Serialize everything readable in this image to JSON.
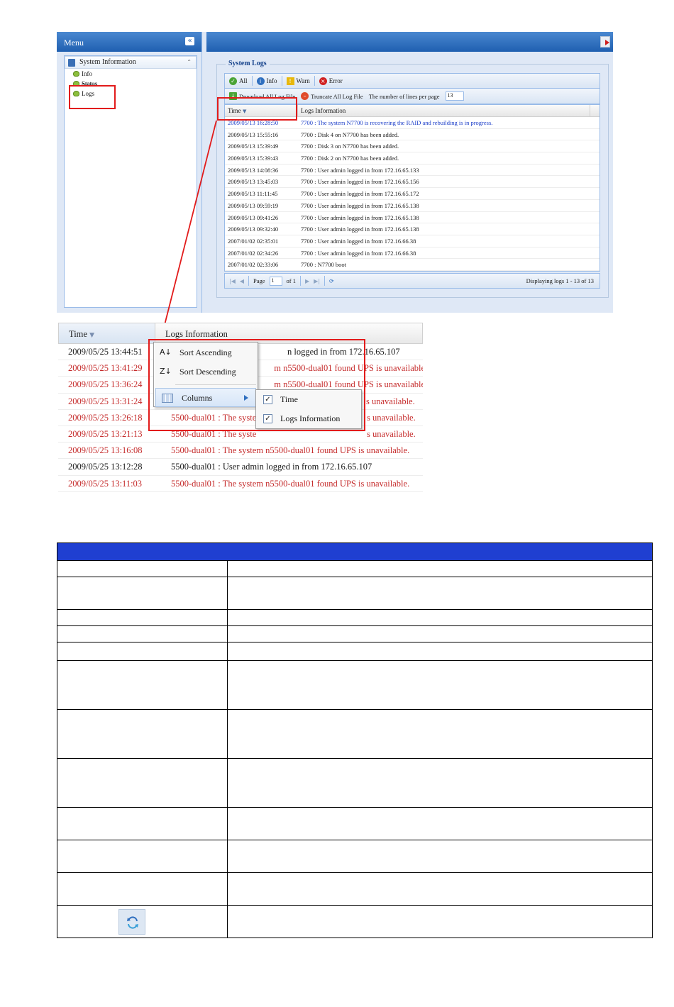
{
  "menu": {
    "title": "Menu",
    "root": "System Information",
    "items": [
      "Info",
      "Status",
      "Logs"
    ]
  },
  "logs_panel": {
    "title": "System Logs",
    "filters": [
      "All",
      "Info",
      "Warn",
      "Error"
    ],
    "download_label": "Download All Log File",
    "truncate_label": "Truncate All Log File",
    "lines_label": "The number of lines per page",
    "lines_value": "13",
    "columns": [
      "Time",
      "Logs Information"
    ],
    "rows": [
      {
        "time": "2009/05/13 16:28:50",
        "info": "7700 : The system N7700 is recovering the RAID and rebuilding is in progress."
      },
      {
        "time": "2009/05/13 15:55:16",
        "info": "7700 : Disk 4 on N7700 has been added."
      },
      {
        "time": "2009/05/13 15:39:49",
        "info": "7700 : Disk 3 on N7700 has been added."
      },
      {
        "time": "2009/05/13 15:39:43",
        "info": "7700 : Disk 2 on N7700 has been added."
      },
      {
        "time": "2009/05/13 14:08:36",
        "info": "7700 : User admin logged in from 172.16.65.133"
      },
      {
        "time": "2009/05/13 13:45:03",
        "info": "7700 : User admin logged in from 172.16.65.156"
      },
      {
        "time": "2009/05/13 11:11:45",
        "info": "7700 : User admin logged in from 172.16.65.172"
      },
      {
        "time": "2009/05/13 09:59:19",
        "info": "7700 : User admin logged in from 172.16.65.138"
      },
      {
        "time": "2009/05/13 09:41:26",
        "info": "7700 : User admin logged in from 172.16.65.138"
      },
      {
        "time": "2009/05/13 09:32:40",
        "info": "7700 : User admin logged in from 172.16.65.138"
      },
      {
        "time": "2007/01/02 02:35:01",
        "info": "7700 : User admin logged in from 172.16.66.38"
      },
      {
        "time": "2007/01/02 02:34:26",
        "info": "7700 : User admin logged in from 172.16.66.38"
      },
      {
        "time": "2007/01/02 02:33:06",
        "info": "7700 : N7700 boot"
      }
    ],
    "pager": {
      "page_label": "Page",
      "page_value": "1",
      "of_label": "of 1",
      "display_text": "Displaying logs 1 - 13 of 13"
    }
  },
  "zoom": {
    "columns": [
      "Time",
      "Logs Information"
    ],
    "rows": [
      {
        "time": "2009/05/25 13:44:51",
        "info": "n logged in from 172.16.65.107",
        "level": "info"
      },
      {
        "time": "2009/05/25 13:41:29",
        "info": "m n5500-dual01 found UPS is unavailable.",
        "level": "error"
      },
      {
        "time": "2009/05/25 13:36:24",
        "info": "m n5500-dual01 found UPS is unavailable.",
        "level": "error"
      },
      {
        "time": "2009/05/25 13:31:24",
        "info": "s unavailable.",
        "level": "error"
      },
      {
        "time": "2009/05/25 13:26:18",
        "info": "5500-dual01 : The syste",
        "level": "error"
      },
      {
        "time": "2009/05/25 13:21:13",
        "info": "5500-dual01 : The syste",
        "level": "error"
      },
      {
        "time": "2009/05/25 13:16:08",
        "info": "5500-dual01 : The system n5500-dual01 found UPS is unavailable.",
        "level": "error"
      },
      {
        "time": "2009/05/25 13:12:28",
        "info": "5500-dual01 : User admin logged in from 172.16.65.107",
        "level": "info"
      },
      {
        "time": "2009/05/25 13:11:03",
        "info": "5500-dual01 : The system n5500-dual01 found UPS is unavailable.",
        "level": "error"
      }
    ],
    "tail_row4": "s unavailable.",
    "tail_row5": "s unavailable.",
    "tail_row6": "s unavailable.",
    "context_menu": {
      "sort_asc": "Sort Ascending",
      "sort_desc": "Sort Descending",
      "columns": "Columns",
      "sub_items": [
        "Time",
        "Logs Information"
      ]
    }
  },
  "colors": {
    "header_blue": "#1f3fd1",
    "highlight_red": "#e21b1b",
    "error_text": "#c52b2b",
    "info_blue": "#1a3cc8"
  },
  "table_rows": 13
}
